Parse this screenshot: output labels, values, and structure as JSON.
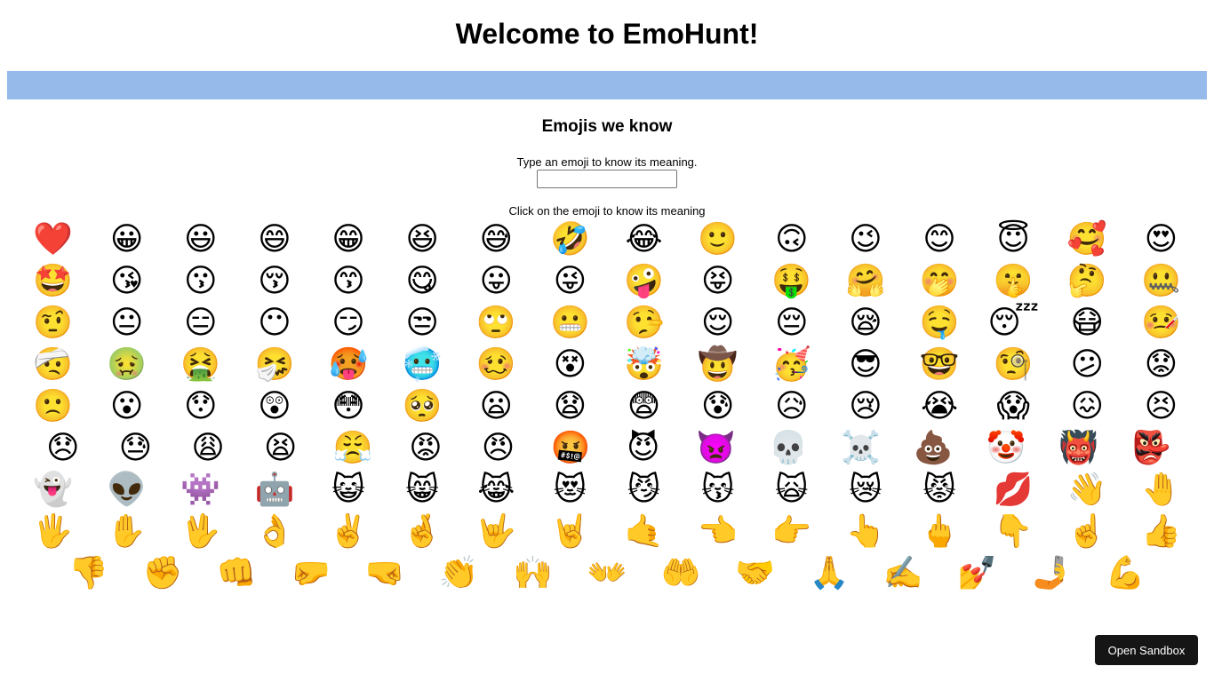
{
  "header": {
    "title": "Welcome to EmoHunt!"
  },
  "section": {
    "title": "Emojis we know",
    "prompt": "Type an emoji to know its meaning.",
    "input_value": "",
    "click_hint": "Click on the emoji to know its meaning"
  },
  "colors": {
    "banner": "#96bbeb",
    "sandbox_button": "#151515"
  },
  "emoji_rows": [
    [
      "❤️",
      "😀",
      "😃",
      "😄",
      "😁",
      "😆",
      "😅",
      "🤣",
      "😂",
      "🙂",
      "🙃",
      "😉",
      "😊",
      "😇",
      "🥰",
      "😍"
    ],
    [
      "🤩",
      "😘",
      "😗",
      "😚",
      "😙",
      "😋",
      "😛",
      "😜",
      "🤪",
      "😝",
      "🤑",
      "🤗",
      "🤭",
      "🤫",
      "🤔",
      "🤐"
    ],
    [
      "🤨",
      "😐",
      "😑",
      "😶",
      "😏",
      "😒",
      "🙄",
      "😬",
      "🤥",
      "😌",
      "😔",
      "😪",
      "🤤",
      "😴",
      "😷",
      "🤒"
    ],
    [
      "🤕",
      "🤢",
      "🤮",
      "🤧",
      "🥵",
      "🥶",
      "🥴",
      "😵",
      "🤯",
      "🤠",
      "🥳",
      "😎",
      "🤓",
      "🧐",
      "😕",
      "😟"
    ],
    [
      "🙁",
      "😮",
      "😯",
      "😲",
      "😳",
      "🥺",
      "😦",
      "😧",
      "😨",
      "😰",
      "😥",
      "😢",
      "😭",
      "😱",
      "😖",
      "😣"
    ],
    [
      "😞",
      "😓",
      "😩",
      "😫",
      "😤",
      "😡",
      "😠",
      "🤬",
      "😈",
      "👿",
      "💀",
      "☠️",
      "💩",
      "🤡",
      "👹",
      "👺"
    ],
    [
      "👻",
      "👽",
      "👾",
      "🤖",
      "😺",
      "😸",
      "😹",
      "😻",
      "😼",
      "😽",
      "🙀",
      "😿",
      "😾",
      "💋",
      "👋",
      "🤚"
    ],
    [
      "🖐️",
      "✋",
      "🖖",
      "👌",
      "✌️",
      "🤞",
      "🤟",
      "🤘",
      "🤙",
      "👈",
      "👉",
      "👆",
      "🖕",
      "👇",
      "☝️",
      "👍"
    ],
    [
      "👎",
      "✊",
      "👊",
      "🤛",
      "🤜",
      "👏",
      "🙌",
      "👐",
      "🤲",
      "🤝",
      "🙏",
      "✍️",
      "💅",
      "🤳",
      "💪"
    ]
  ],
  "sandbox_button": {
    "label": "Open Sandbox"
  }
}
